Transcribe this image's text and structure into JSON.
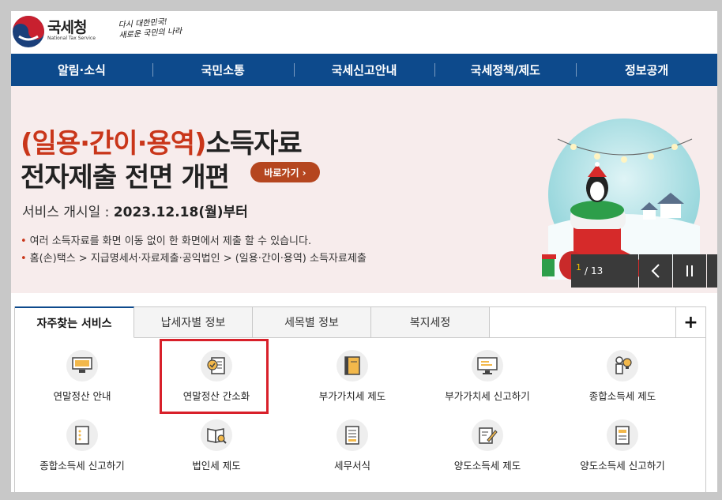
{
  "header": {
    "logo_text": "국세청",
    "logo_subtext": "National Tax Service",
    "slogan_line1": "다시 대한민국!",
    "slogan_line2": "새로운 국민의 나라"
  },
  "nav": {
    "items": [
      "알림·소식",
      "국민소통",
      "국세신고안내",
      "국세정책/제도",
      "정보공개"
    ]
  },
  "banner": {
    "title_highlight": "(일용·간이·용역)",
    "title_rest": "소득자료",
    "title_line2": "전자제출 전면 개편",
    "button_label": "바로가기 ›",
    "date_label": "서비스 개시일 : ",
    "date_value": "2023.12.18(월)부터",
    "desc1": "여러 소득자료를 화면 이동 없이 한 화면에서 제출 할 수 있습니다.",
    "desc2": "홈(손)택스 > 지급명세서·자료제출·공익법인 > (일용·간이·용역) 소득자료제출",
    "slide_current": "1",
    "slide_separator": "/",
    "slide_total": "13"
  },
  "tabs": {
    "items": [
      "자주찾는 서비스",
      "납세자별 정보",
      "세목별 정보",
      "복지세정"
    ],
    "active_index": 0,
    "plus_label": "+"
  },
  "services": [
    {
      "label": "연말정산 안내",
      "icon": "calculator-screen-icon"
    },
    {
      "label": "연말정산 간소화",
      "icon": "document-check-icon"
    },
    {
      "label": "부가가치세 제도",
      "icon": "book-icon"
    },
    {
      "label": "부가가치세 신고하기",
      "icon": "monitor-icon"
    },
    {
      "label": "종합소득세 제도",
      "icon": "person-lightbulb-icon"
    },
    {
      "label": "종합소득세 신고하기",
      "icon": "checklist-icon"
    },
    {
      "label": "법인세 제도",
      "icon": "book-search-icon"
    },
    {
      "label": "세무서식",
      "icon": "form-document-icon"
    },
    {
      "label": "양도소득세 제도",
      "icon": "document-pen-icon"
    },
    {
      "label": "양도소득세 신고하기",
      "icon": "report-document-icon"
    }
  ],
  "colors": {
    "nav_bg": "#0d4a8c",
    "highlight": "#c9361a",
    "button": "#b5461f",
    "annotation_box": "#d8202a",
    "banner_bg": "#f7ecec"
  }
}
